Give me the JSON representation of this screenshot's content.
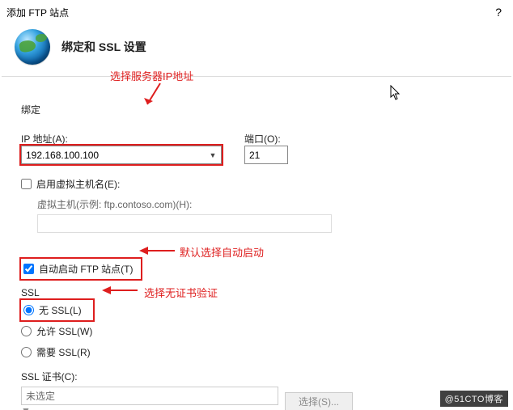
{
  "title": "添加 FTP 站点",
  "help": "?",
  "header": "绑定和 SSL 设置",
  "binding": {
    "legend": "绑定",
    "ip_label": "IP 地址(A):",
    "ip_value": "192.168.100.100",
    "port_label": "端口(O):",
    "port_value": "21",
    "vh_enable": "启用虚拟主机名(E):",
    "vh_hint": "虚拟主机(示例: ftp.contoso.com)(H):",
    "vh_value": ""
  },
  "auto_start": "自动启动 FTP 站点(T)",
  "ssl": {
    "legend": "SSL",
    "no_ssl": "无 SSL(L)",
    "allow_ssl": "允许 SSL(W)",
    "require_ssl": "需要 SSL(R)",
    "cert_label": "SSL 证书(C):",
    "cert_value": "未选定",
    "select_btn": "选择(S)..."
  },
  "annotations": {
    "a1": "选择服务器IP地址",
    "a2": "默认选择自动启动",
    "a3": "选择无证书验证"
  },
  "watermark": "@51CTO博客"
}
